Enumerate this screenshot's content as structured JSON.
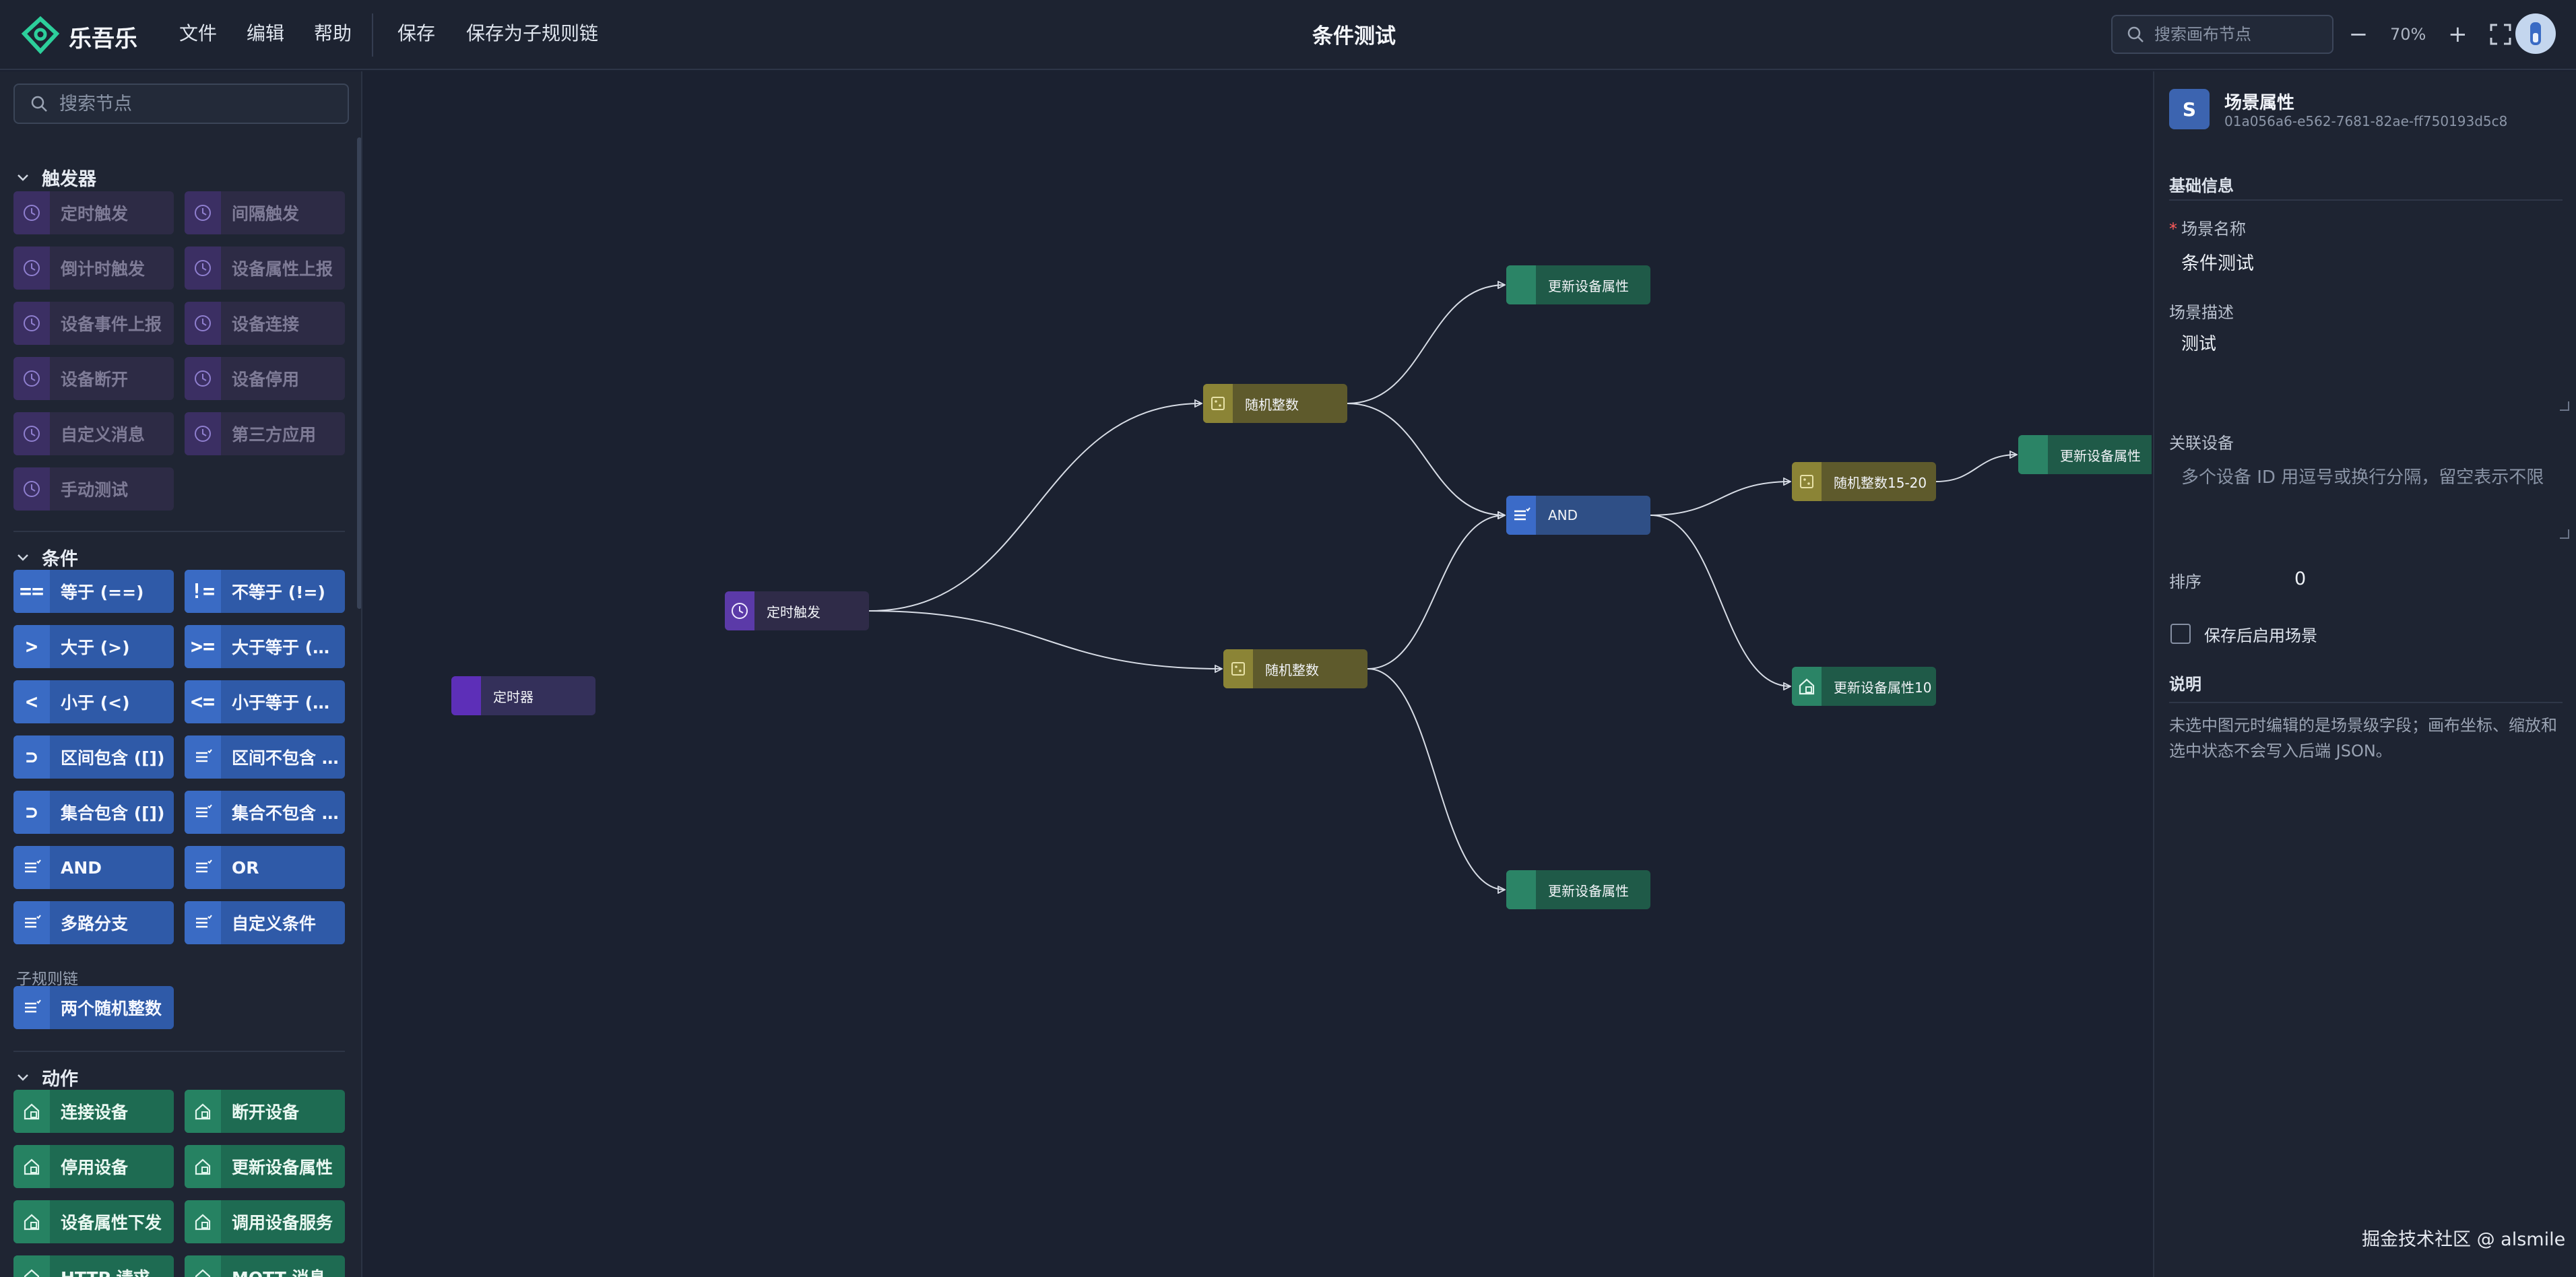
{
  "app": {
    "name": "乐吾乐",
    "logo_icon": "logo-mark-icon"
  },
  "menu": [
    "文件",
    "编辑",
    "帮助"
  ],
  "toolbar": {
    "save": "保存",
    "save_as_subchain": "保存为子规则链"
  },
  "title": "条件测试",
  "header_search": {
    "placeholder": "搜索画布节点"
  },
  "zoom": {
    "level": "70%"
  },
  "sidebar": {
    "search_placeholder": "搜索节点",
    "sections": [
      {
        "title": "触发器",
        "items": [
          "定时触发",
          "间隔触发",
          "倒计时触发",
          "设备属性上报",
          "设备事件上报",
          "设备连接",
          "设备断开",
          "设备停用",
          "自定义消息",
          "第三方应用",
          "手动测试"
        ]
      },
      {
        "title": "条件",
        "items": [
          "等于 (==)",
          "不等于 (!=)",
          "大于 (>)",
          "大于等于 (>=)",
          "小于 (<)",
          "小于等于 (<=)",
          "区间包含 ([])",
          "区间不包含 (![])",
          "集合包含 ([])",
          "集合不包含 (![])",
          "AND",
          "OR",
          "多路分支",
          "自定义条件"
        ]
      },
      {
        "title": "子规则链",
        "items": [
          "两个随机整数"
        ]
      },
      {
        "title": "动作",
        "items": [
          "连接设备",
          "断开设备",
          "停用设备",
          "更新设备属性",
          "设备属性下发",
          "调用设备服务",
          "HTTP 请求",
          "MQTT 消息"
        ]
      }
    ],
    "cond_glyphs": [
      "==",
      "!=",
      ">",
      ">=",
      "<",
      "<=",
      "⊃",
      "≡",
      "⊃",
      "≡",
      "≡",
      "≡",
      "≡",
      "≡"
    ]
  },
  "canvas": {
    "nodes": [
      {
        "label": "定时器",
        "kind": "timer"
      },
      {
        "label": "定时触发",
        "kind": "trig"
      },
      {
        "label": "随机整数",
        "kind": "rand"
      },
      {
        "label": "随机整数",
        "kind": "rand"
      },
      {
        "label": "AND",
        "kind": "andn"
      },
      {
        "label": "随机整数15-20",
        "kind": "rand"
      },
      {
        "label": "更新设备属性",
        "kind": "upd"
      },
      {
        "label": "更新设备属性",
        "kind": "upd"
      },
      {
        "label": "更新设备属性",
        "kind": "upd"
      },
      {
        "label": "更新设备属性10",
        "kind": "upd"
      }
    ],
    "edge_color": "#d8dde6"
  },
  "panel": {
    "badge": "S",
    "title": "场景属性",
    "id": "01a056a6-e562-7681-82ae-ff750193d5c8",
    "section_basic": "基础信息",
    "name_label": "场景名称",
    "name_value": "条件测试",
    "desc_label": "场景描述",
    "desc_value": "测试",
    "devices_label": "关联设备",
    "devices_placeholder": "多个设备 ID 用逗号或换行分隔，留空表示不限",
    "order_label": "排序",
    "order_value": "0",
    "enable_label": "保存后启用场景",
    "note_title": "说明",
    "note_text": "未选中图元时编辑的是场景级字段；画布坐标、缩放和选中状态不会写入后端 JSON。"
  },
  "footer": "掘金技术社区 @ alsmile",
  "colors": {
    "accent": "#3a6bc4",
    "trigger": "#5b3aa8",
    "condition": "#2f5aa8",
    "action": "#1e6b52",
    "random": "#8b8436"
  }
}
